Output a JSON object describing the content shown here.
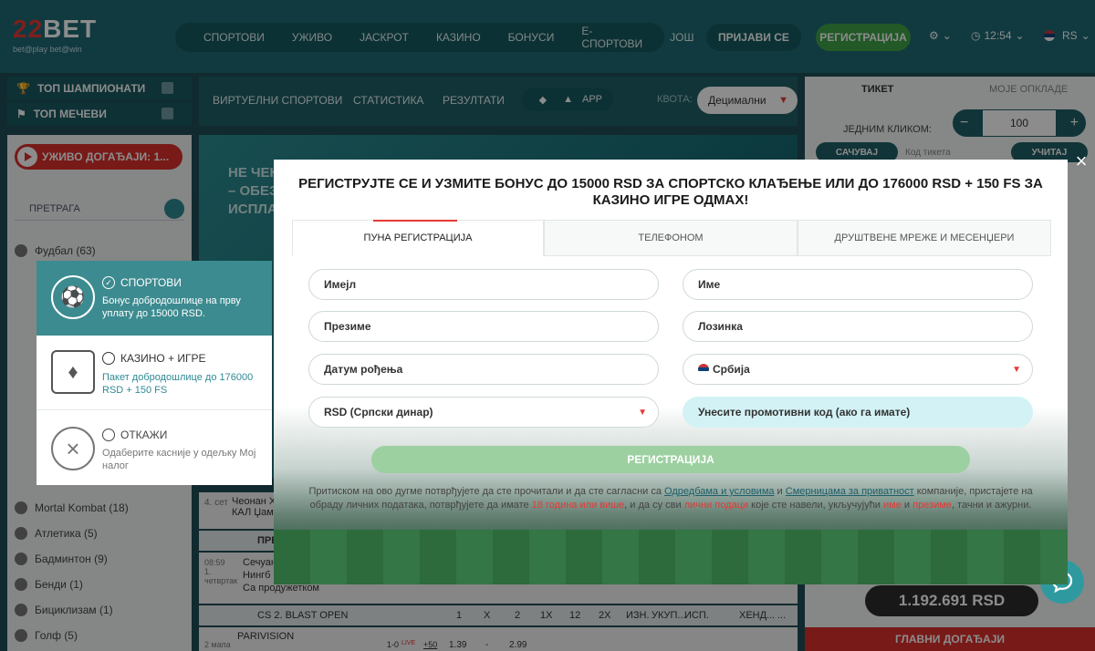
{
  "header": {
    "logo_main": "22BET",
    "logo_sub": "bet@play bet@win",
    "nav": [
      "СПОРТОВИ",
      "УЖИВО",
      "ЈАСКРОТ",
      "КАЗИНО",
      "БОНУСИ",
      "Е-СПОРТОВИ",
      "ЈОШ"
    ],
    "login": "ПРИЈАВИ СЕ",
    "register": "РЕГИСТРАЦИЈА",
    "time": "12:54",
    "lang": "RS"
  },
  "sidebar": {
    "top_champs": "ТОП ШАМПИОНАТИ",
    "top_matches": "ТОП МЕЧЕВИ",
    "live": "УЖИВО ДОГАЂАЈИ: 1...",
    "search": "ПРЕТРАГА",
    "sports": [
      "Фудбал (63)",
      "Mortal Kombat (18)",
      "Атлетика (5)",
      "Бадминтон (9)",
      "Бенди (1)",
      "Бициклизам (1)",
      "Голф (5)"
    ]
  },
  "center": {
    "tabs": [
      "ВИРТУЕЛНИ СПОРТОВИ",
      "СТАТИСТИКА",
      "РЕЗУЛТАТИ"
    ],
    "app": "APP",
    "kvota_label": "КВОТА:",
    "kvota_value": "Децимални",
    "banner_text": "НЕ ЧЕК\n– ОБЕЗ\nИСПЛАТ",
    "rows": [
      {
        "date": "4. сет",
        "text": "Чеонан Х\nКАЛ Џам"
      },
      {
        "date": "",
        "text": "ПРЕ"
      },
      {
        "date": "08:59\n1.\nчетвртак",
        "text": "Сечуан\nНингб\nСа продужетком"
      },
      {
        "date": "",
        "text": "CS 2. BLAST OPEN",
        "cols": [
          "1",
          "X",
          "2",
          "1X",
          "12",
          "2X",
          "ИЗН.",
          "УКУП...",
          "ИСП.",
          "ХЕНД...",
          "..."
        ]
      },
      {
        "date": "2 мапа",
        "text": "PARIVISION",
        "score": "1-0",
        "live": "LIVE",
        "more": "+50",
        "odds": [
          "1.39",
          "-",
          "2.99",
          "-",
          "-",
          "-",
          "-",
          "-",
          "-"
        ]
      }
    ]
  },
  "ticket": {
    "tab_ticket": "ТИКЕТ",
    "tab_mybets": "МОЈЕ ОПКЛАДЕ",
    "one_click": "ЈЕДНИМ КЛИКОМ:",
    "stake": "100",
    "save": "САЧУВАЈ",
    "code_placeholder": "Код тикета",
    "load": "УЧИТАЈ",
    "jackpot": "1.192.691 RSD",
    "main_events": "ГЛАВНИ ДОГАЂАЈИ"
  },
  "bonus": {
    "options": [
      {
        "title": "СПОРТОВИ",
        "desc": "Бонус добродошлице на прву уплату до 15000 RSD.",
        "icon": "soccer-ball-icon"
      },
      {
        "title": "КАЗИНО + ИГРЕ",
        "desc": "Пакет добродошлице до 176000 RSD + 150 FS",
        "icon": "casino-chips-icon"
      },
      {
        "title": "ОТКАЖИ",
        "desc": "Одаберите касније у одељку Мој налог",
        "icon": "cancel-icon"
      }
    ]
  },
  "modal": {
    "title": "РЕГИСТРУЈТЕ СЕ И УЗМИТЕ БОНУС ДО 15000 RSD ЗА СПОРТСКО КЛАЂЕЊЕ ИЛИ ДО 176000 RSD + 150 FS ЗА КАЗИНО ИГРЕ ОДМАХ!",
    "tabs": [
      "ПУНА РЕГИСТРАЦИЈА",
      "ТЕЛЕФОНОМ",
      "ДРУШТВЕНЕ МРЕЖЕ И МЕСЕНЏЕРИ"
    ],
    "fields": {
      "email": "Имејл",
      "name": "Име",
      "surname": "Презиме",
      "password": "Лозинка",
      "dob": "Датум рођења",
      "country": "Србија",
      "currency": "RSD (Српски динар)",
      "promo": "Унесите промотивни код (ако га имате)"
    },
    "register_button": "РЕГИСТРАЦИЈА",
    "terms": {
      "p1": "Притиском на ово дугме потврђујете да сте прочитали и да сте сагласни са ",
      "l1": "Одредбама и условима",
      "p2": " и ",
      "l2": "Смерницама за приватност",
      "p3": " компаније, пристајете на обраду личних података, потврђујете да имате ",
      "r1": "18 година или више",
      "p4": ", и да су сви ",
      "r2": "лични подаци",
      "p5": " које сте навели, укључујући ",
      "r3": "име",
      "p6": " и ",
      "r4": "презиме",
      "p7": ", тачни и ажурни."
    }
  }
}
